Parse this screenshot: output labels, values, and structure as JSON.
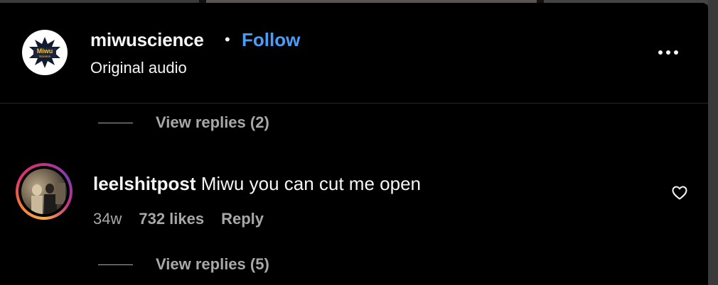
{
  "post": {
    "username": "miwuscience",
    "separator": "•",
    "follow_label": "Follow",
    "subtitle": "Original audio",
    "avatar_logo_text_1": "Miwu",
    "avatar_logo_text_2": "Science"
  },
  "threads": [
    {
      "replies_label": "View replies (2)"
    },
    {
      "replies_label": "View replies (5)"
    }
  ],
  "comment": {
    "username": "leelshitpost",
    "text": "Miwu you can cut me open",
    "age": "34w",
    "likes": "732 likes",
    "reply_label": "Reply"
  },
  "colors": {
    "background": "#000000",
    "text": "#f5f5f5",
    "muted": "#a8a8a8",
    "follow": "#4a9df8"
  }
}
